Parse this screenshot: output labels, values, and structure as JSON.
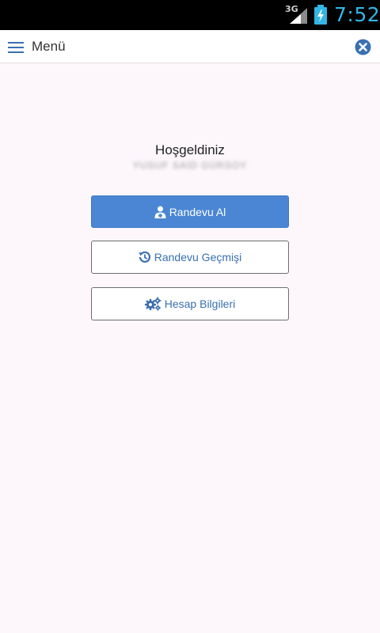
{
  "status_bar": {
    "network": "3G",
    "time": "7:52"
  },
  "app_bar": {
    "title": "Menü",
    "icons": {
      "menu": "hamburger-menu-icon",
      "close": "close-circle-icon"
    }
  },
  "main": {
    "welcome": "Hoşgeldiniz",
    "user_name": "YUSUF SAİD GÜRSOY",
    "buttons": [
      {
        "label": "Randevu Al",
        "icon": "user-doctor-icon",
        "style": "primary"
      },
      {
        "label": "Randevu Geçmişi",
        "icon": "history-icon",
        "style": "outline"
      },
      {
        "label": "Hesap Bilgileri",
        "icon": "cogs-icon",
        "style": "outline"
      }
    ]
  },
  "colors": {
    "primary": "#4a86d4",
    "link": "#3a6fb0",
    "status_time": "#33b5e5",
    "background": "#fdf7fc"
  }
}
